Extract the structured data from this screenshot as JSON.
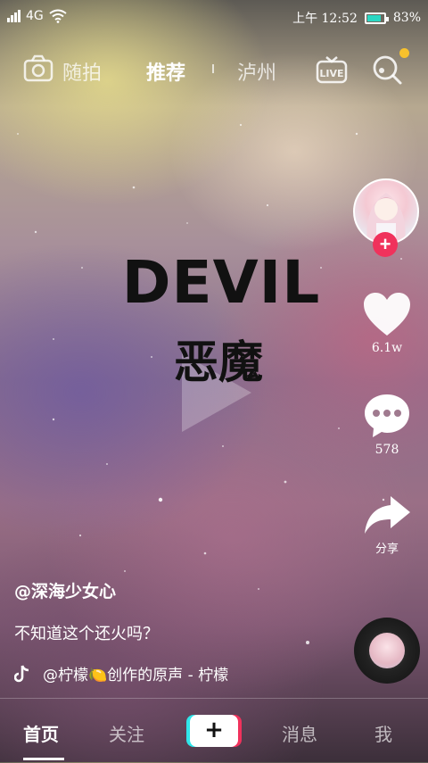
{
  "status_bar": {
    "network": "4G",
    "time": "上午 12:52",
    "battery": "83%",
    "battery_level": 0.83
  },
  "top_nav": {
    "random_shot": "随拍",
    "recommend": "推荐",
    "city": "泸州",
    "live_label": "LIVE",
    "notification_dot_color": "#f7c12d"
  },
  "video": {
    "title_en": "DEVIL",
    "title_cn": "恶魔"
  },
  "side_actions": {
    "follow_plus": "+",
    "likes": "6.1w",
    "comments": "578",
    "share": "分享",
    "accent_color": "#f0325c"
  },
  "info": {
    "author": "@深海少女心",
    "description": "不知道这个还火吗？",
    "music": "@柠檬🍋创作的原声 - 柠檬"
  },
  "bottom_nav": {
    "home": "首页",
    "follow": "关注",
    "create": "+",
    "messages": "消息",
    "me": "我"
  }
}
